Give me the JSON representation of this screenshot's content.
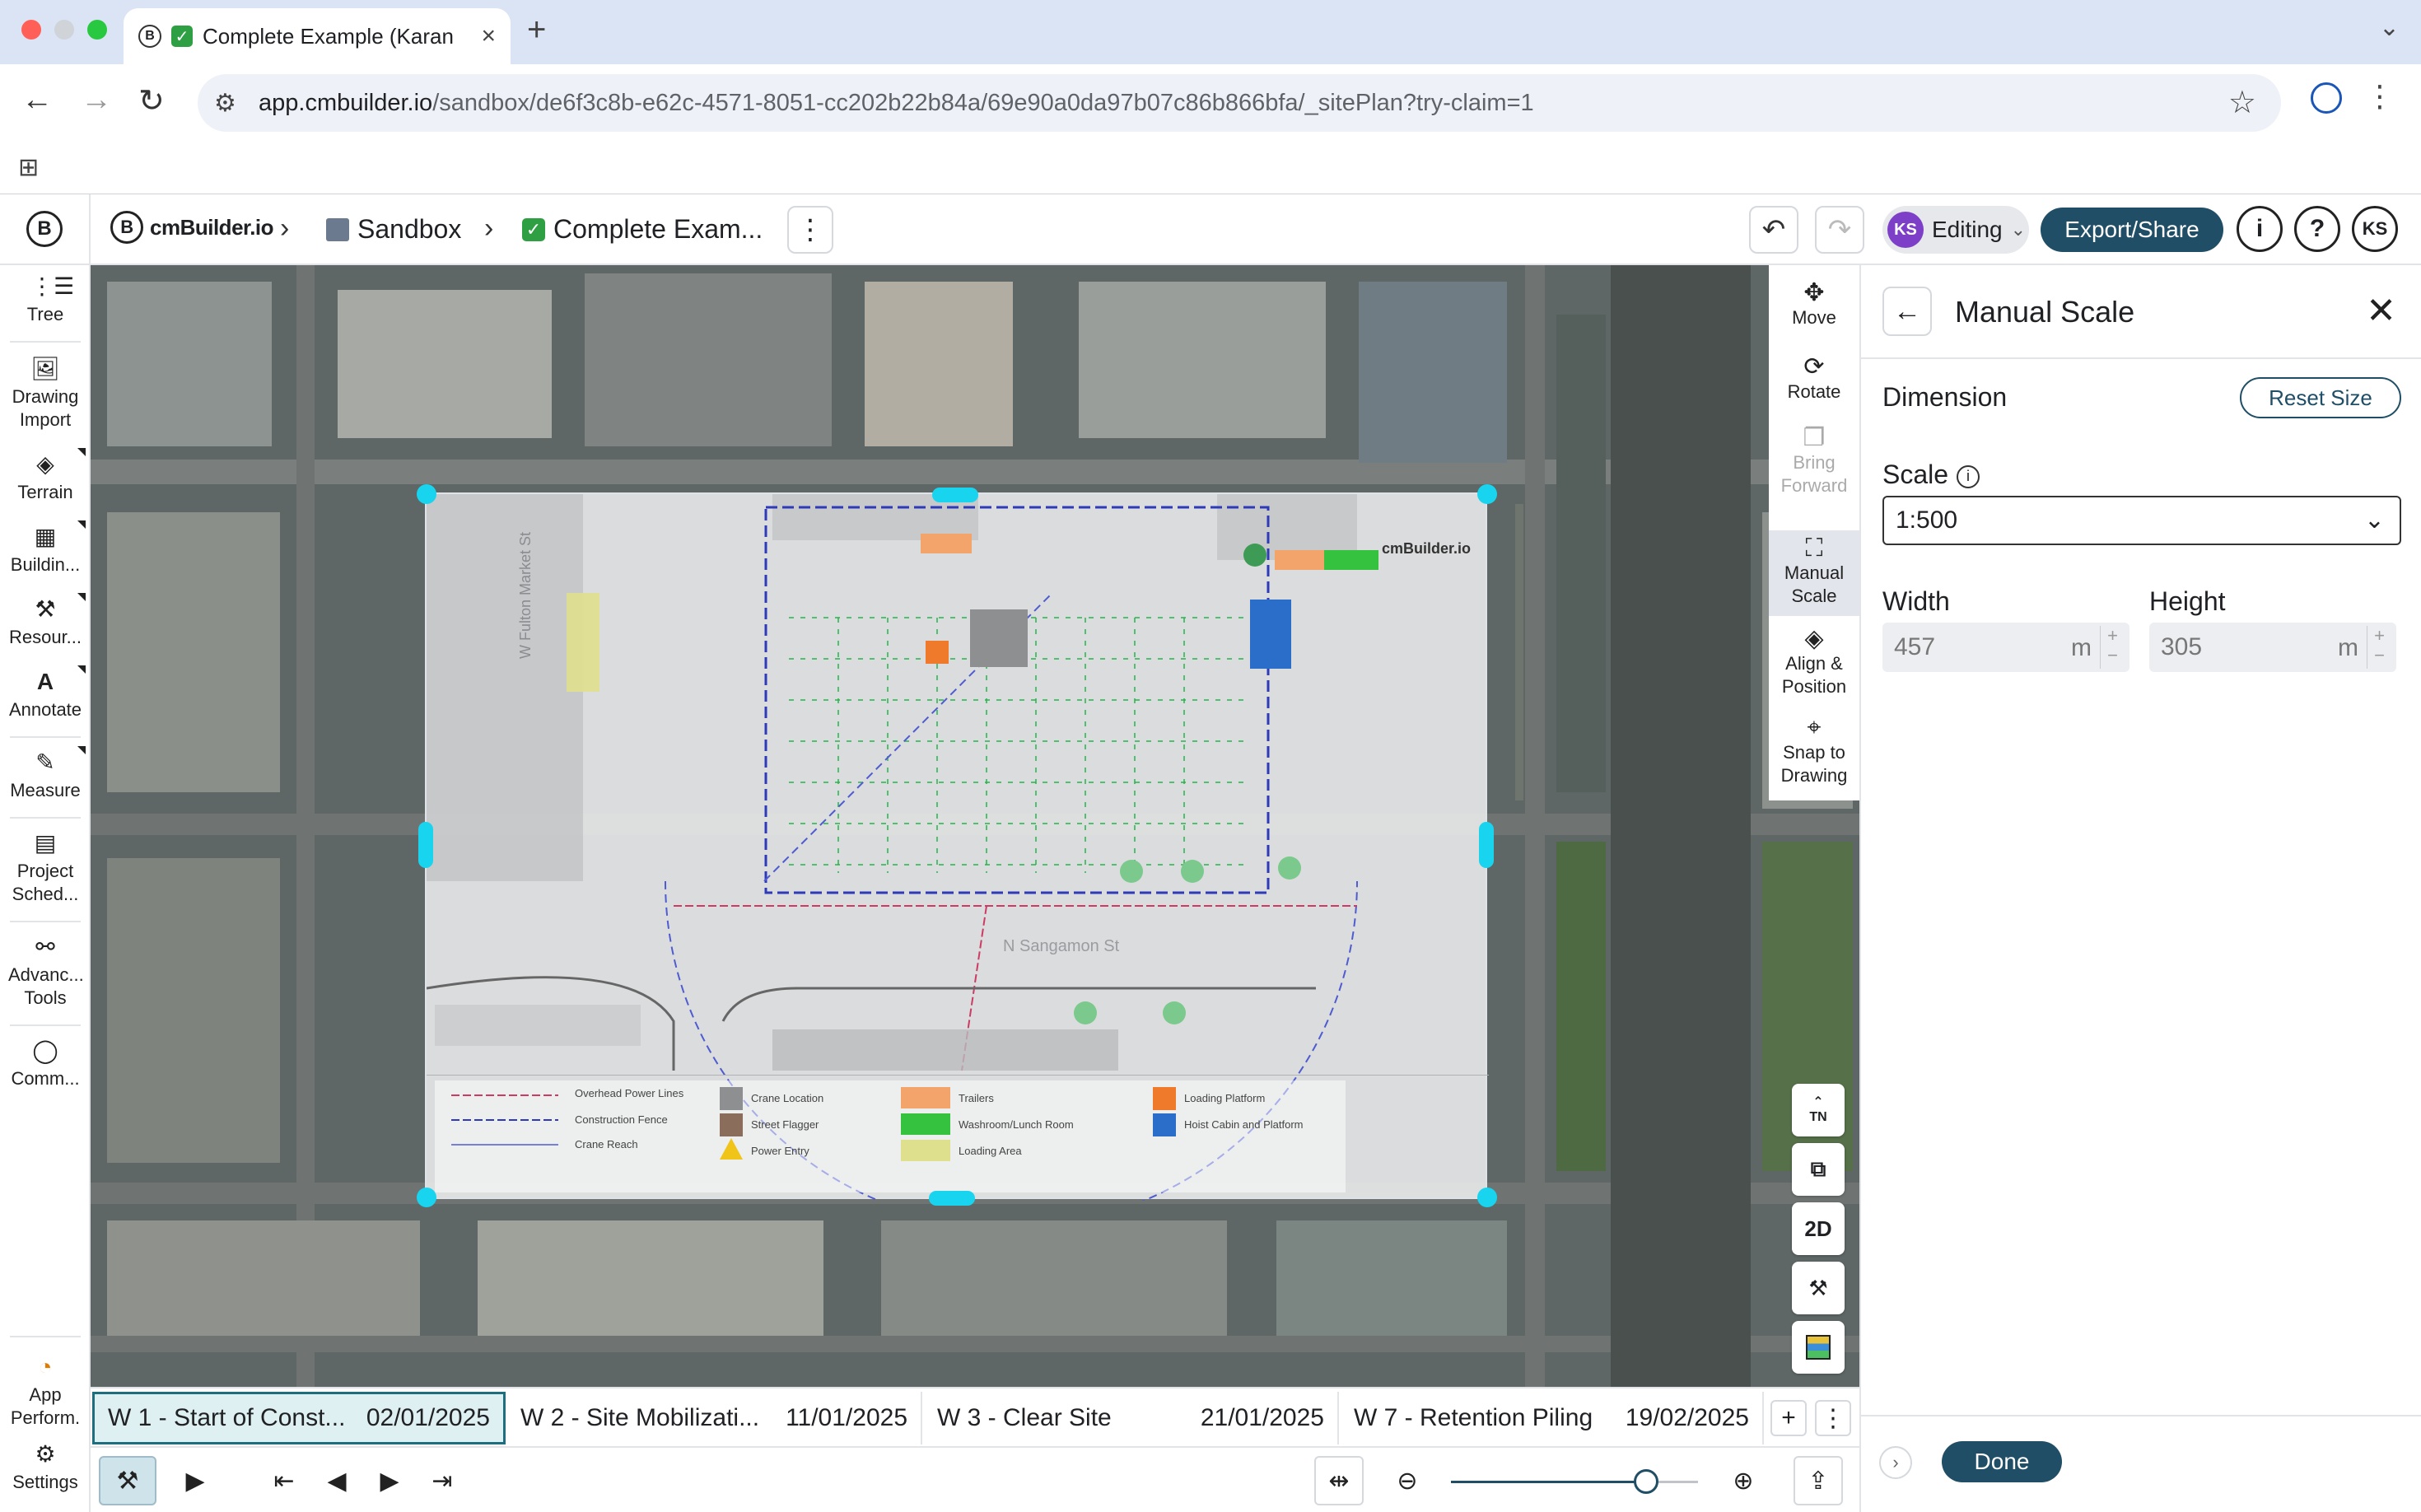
{
  "browser": {
    "tab_title": "Complete Example (Karan",
    "url_host": "app.cmbuilder.io",
    "url_path": "/sandbox/de6f3c8b-e62c-4571-8051-cc202b22b84a/69e90a0da97b07c86b866bfa/_sitePlan?try-claim=1"
  },
  "header": {
    "brand": "cmBuilder.io",
    "crumb_sandbox": "Sandbox",
    "crumb_project": "Complete Exam...",
    "mode": "Editing",
    "user_initials": "KS",
    "export_label": "Export/Share"
  },
  "sidebar": {
    "items": [
      {
        "label": "Tree"
      },
      {
        "label": "Drawing Import"
      },
      {
        "label": "Terrain"
      },
      {
        "label": "Buildin..."
      },
      {
        "label": "Resour..."
      },
      {
        "label": "Annotate"
      },
      {
        "label": "Measure"
      },
      {
        "label": "Project Sched..."
      },
      {
        "label": "Advanc... Tools"
      },
      {
        "label": "Comm..."
      },
      {
        "label": "App Perform."
      },
      {
        "label": "Settings"
      }
    ]
  },
  "tools": {
    "move": "Move",
    "rotate": "Rotate",
    "bring_forward": "Bring Forward",
    "manual_scale": "Manual Scale",
    "align_position": "Align & Position",
    "snap_to_drawing": "Snap to Drawing",
    "north_label": "TN",
    "view_2d": "2D"
  },
  "drawing": {
    "street_w_fulton_market": "W Fulton Market St",
    "street_n_sangamon": "N Sangamon St",
    "legend": [
      "Overhead Power Lines",
      "Construction Fence",
      "Crane Reach",
      "Crane Location",
      "Street Flagger",
      "Power Entry",
      "Trailers",
      "Washroom/Lunch Room",
      "Loading Area",
      "Loading Platform",
      "Hoist Cabin and Platform"
    ]
  },
  "phases": [
    {
      "name": "W 1 - Start of Const...",
      "date": "02/01/2025",
      "active": true
    },
    {
      "name": "W 2 - Site Mobilizati...",
      "date": "11/01/2025",
      "active": false
    },
    {
      "name": "W 3 - Clear Site",
      "date": "21/01/2025",
      "active": false
    },
    {
      "name": "W 7 - Retention Piling",
      "date": "19/02/2025",
      "active": false
    }
  ],
  "zoom": {
    "level": 0.79
  },
  "panel": {
    "title": "Manual Scale",
    "dimension_label": "Dimension",
    "reset_label": "Reset Size",
    "scale_label": "Scale",
    "scale_value": "1:500",
    "width_label": "Width",
    "width_value": "457",
    "width_unit": "m",
    "height_label": "Height",
    "height_value": "305",
    "height_unit": "m",
    "done_label": "Done"
  },
  "colors": {
    "accent": "#1f4e66",
    "handle": "#18d4ee",
    "avatar": "#7d3fc8",
    "check": "#2ea043"
  }
}
